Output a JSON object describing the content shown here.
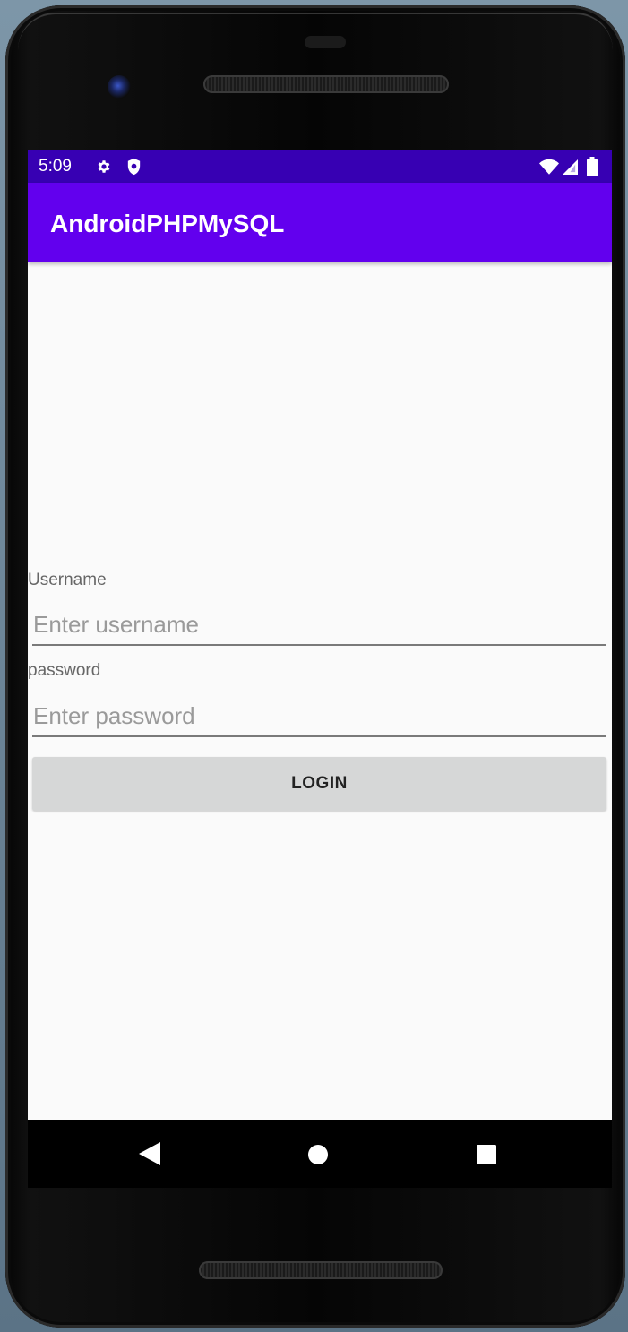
{
  "status_bar": {
    "time": "5:09",
    "icons": [
      "settings-icon",
      "shield-icon",
      "wifi-icon",
      "signal-icon",
      "battery-icon"
    ],
    "background_color": "#3700b3"
  },
  "app_bar": {
    "title": "AndroidPHPMySQL",
    "background_color": "#6200ee"
  },
  "form": {
    "username_label": "Username",
    "username_placeholder": "Enter username",
    "username_value": "",
    "password_label": "password",
    "password_placeholder": "Enter password",
    "password_value": "",
    "login_label": "LOGIN"
  },
  "nav_bar": {
    "icons": [
      "back-icon",
      "home-icon",
      "recents-icon"
    ]
  }
}
